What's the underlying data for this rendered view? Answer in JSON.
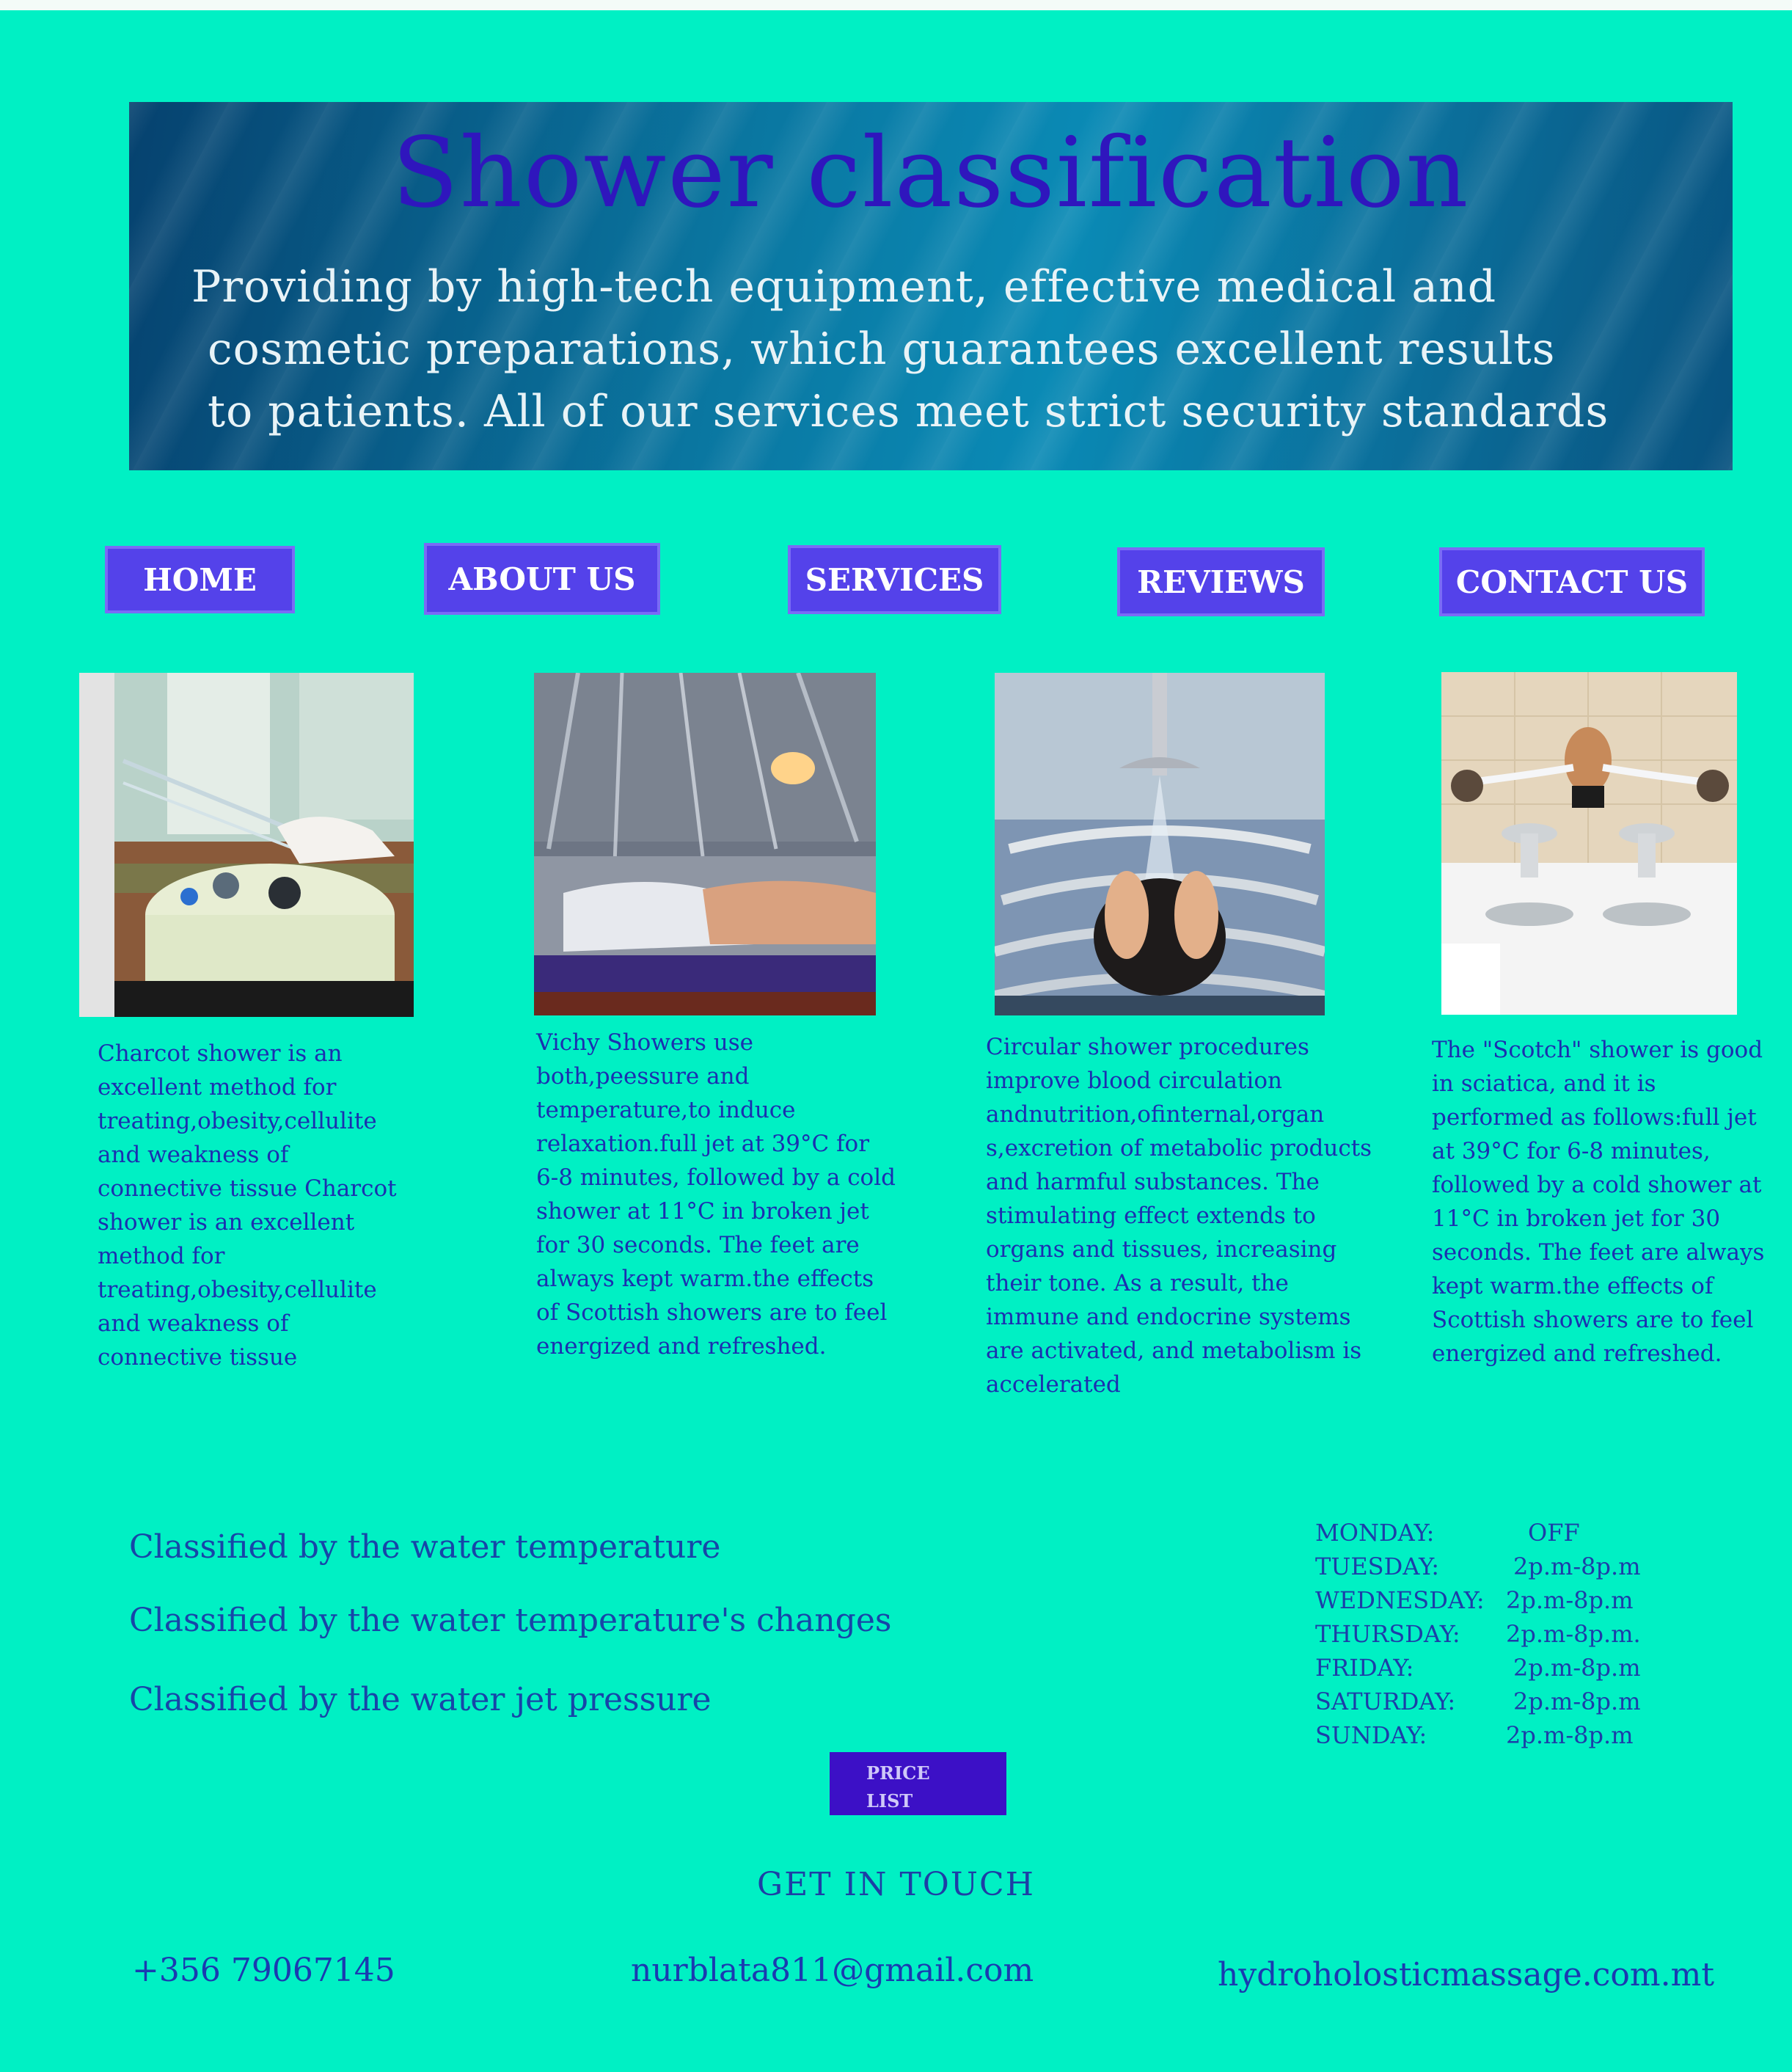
{
  "banner": {
    "title": "Shower classification",
    "subtitle": [
      "Providing by high-tech equipment, effective medical and",
      "cosmetic preparations, which guarantees excellent results",
      "to patients. All of our services meet strict security standards"
    ]
  },
  "nav": {
    "home": "HOME",
    "about": "ABOUT US",
    "services": "SERVICES",
    "reviews": "REVIEWS",
    "contact": "CONTACT US"
  },
  "cards": [
    {
      "text": "Charcot shower is an excellent method for treating,obesity,cellulite and weakness of connective tissue Charcot shower is an excellent method for treating,obesity,cellulite and weakness of connective tissue"
    },
    {
      "text": "Vichy Showers use both,peessure and temperature,to induce relaxation.full jet at 39°C for 6-8 minutes, followed by a cold shower at 11°C in broken jet for 30 seconds. The feet are always kept warm.the effects of Scottish showers are to feel energized and refreshed."
    },
    {
      "text": "Circular shower procedures improve blood circulation andnutrition,ofinternal,organ s,excretion of metabolic products and harmful substances. The stimulating effect extends to organs and tissues, increasing their tone. As a result, the immune and endocrine systems are activated, and metabolism is accelerated"
    },
    {
      "text": "The \"Scotch\" shower is good in sciatica, and it is performed as follows:full jet at 39°C for 6-8 minutes, followed by a cold shower at 11°C in broken jet for 30 seconds. The feet are always kept warm.the effects of Scottish showers are to feel energized and refreshed."
    }
  ],
  "classified": [
    "Classified by the water temperature",
    "Classified by the water temperature's changes",
    "Classified by the water jet pressure"
  ],
  "hours": [
    {
      "day": "MONDAY:",
      "time": "OFF"
    },
    {
      "day": "TUESDAY:",
      "time": "2p.m-8p.m"
    },
    {
      "day": "WEDNESDAY:",
      "time": "2p.m-8p.m"
    },
    {
      "day": "THURSDAY:",
      "time": "2p.m-8p.m."
    },
    {
      "day": "FRIDAY:",
      "time": "2p.m-8p.m"
    },
    {
      "day": "SATURDAY:",
      "time": "2p.m-8p.m"
    },
    {
      "day": "SUNDAY:",
      "time": "2p.m-8p.m"
    }
  ],
  "price_button": {
    "line1": "PRICE",
    "line2": "LIST"
  },
  "get_in_touch": "GET IN TOUCH",
  "contact": {
    "phone": "+356 79067145",
    "email": "nurblata811@gmail.com",
    "website": "hydroholosticmassage.com.mt"
  },
  "colors": {
    "background": "#00F0C4",
    "nav_button": "#5442EA",
    "title": "#2F16BD",
    "price_button": "#3C10C6"
  }
}
